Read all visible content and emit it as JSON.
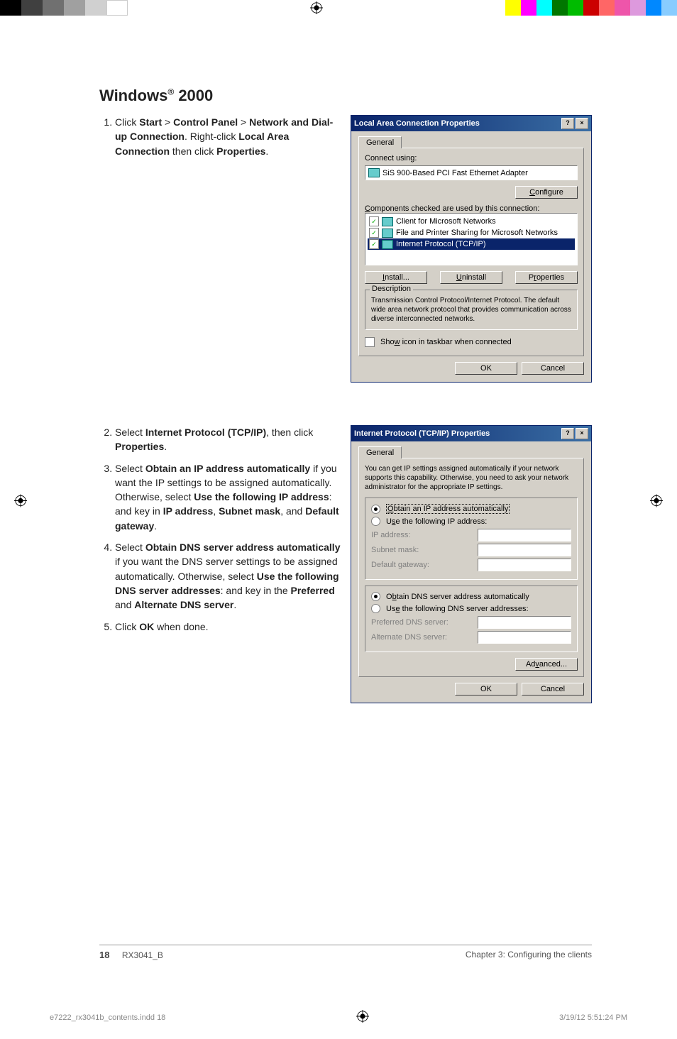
{
  "section_title_prefix": "Windows",
  "section_title_reg": "®",
  "section_title_suffix": " 2000",
  "step1": {
    "num": "1.",
    "t1": "Click ",
    "b1": "Start",
    "t2": " > ",
    "b2": "Control Panel",
    "t3": " > ",
    "b3": "Network and Dial-up Connection",
    "t4": ". Right-click ",
    "b4": "Local Area Connection",
    "t5": " then click ",
    "b5": "Properties",
    "t6": "."
  },
  "step2": {
    "t1": "Select ",
    "b1": "Internet Protocol (TCP/IP)",
    "t2": ", then click ",
    "b2": "Properties",
    "t3": "."
  },
  "step3": {
    "t1": "Select ",
    "b1": "Obtain an IP address automatically",
    "t2": " if you want the IP settings to be assigned automatically. Otherwise, select ",
    "b2": "Use the following IP address",
    "t3": ": and key in ",
    "b3": "IP address",
    "t4": ", ",
    "b4": "Subnet mask",
    "t5": ", and ",
    "b5": "Default gateway",
    "t6": "."
  },
  "step4": {
    "t1": "Select ",
    "b1": "Obtain DNS server address automatically",
    "t2": " if you want the DNS server settings to be assigned automatically. Otherwise, select ",
    "b2": "Use the following DNS server addresses",
    "t3": ": and key in the ",
    "b3": "Preferred",
    "t4": " and ",
    "b4": "Alternate DNS server",
    "t5": "."
  },
  "step5": {
    "t1": "Click ",
    "b1": "OK",
    "t2": " when done."
  },
  "dialog1": {
    "title": "Local Area Connection Properties",
    "tab": "General",
    "connect_using": "Connect using:",
    "adapter": "SiS 900-Based PCI Fast Ethernet Adapter",
    "configure": "Configure",
    "components_label": "Components checked are used by this connection:",
    "items": {
      "a": "Client for Microsoft Networks",
      "b": "File and Printer Sharing for Microsoft Networks",
      "c": "Internet Protocol (TCP/IP)"
    },
    "install": "Install...",
    "uninstall": "Uninstall",
    "properties": "Properties",
    "desc_title": "Description",
    "desc_text": "Transmission Control Protocol/Internet Protocol. The default wide area network protocol that provides communication across diverse interconnected networks.",
    "show_icon": "Show icon in taskbar when connected",
    "ok": "OK",
    "cancel": "Cancel"
  },
  "dialog2": {
    "title": "Internet Protocol (TCP/IP) Properties",
    "tab": "General",
    "intro": "You can get IP settings assigned automatically if your network supports this capability. Otherwise, you need to ask your network administrator for the appropriate IP settings.",
    "r1": "Obtain an IP address automatically",
    "r2": "Use the following IP address:",
    "ip": "IP address:",
    "mask": "Subnet mask:",
    "gw": "Default gateway:",
    "r3": "Obtain DNS server address automatically",
    "r4": "Use the following DNS server addresses:",
    "pdns": "Preferred DNS server:",
    "adns": "Alternate DNS server:",
    "advanced": "Advanced...",
    "ok": "OK",
    "cancel": "Cancel"
  },
  "footer": {
    "page": "18",
    "doc": "RX3041_B",
    "chapter": "Chapter 3: Configuring the clients"
  },
  "indd": {
    "file": "e7222_rx3041b_contents.indd   18",
    "date": "3/19/12   5:51:24 PM"
  },
  "colorbar": [
    "#000",
    "#404040",
    "#707070",
    "#a0a0a0",
    "#d0d0d0",
    "#fff",
    "#fff",
    "#fff",
    "#fff",
    "#fff",
    "#fff",
    "#fff",
    "#fff",
    "#fff",
    "#ff0",
    "#f0f",
    "#0ff",
    "#080",
    "#0b0",
    "#f00",
    "#f77",
    "#f0a",
    "#d8d",
    "#0af",
    "#9cf"
  ]
}
